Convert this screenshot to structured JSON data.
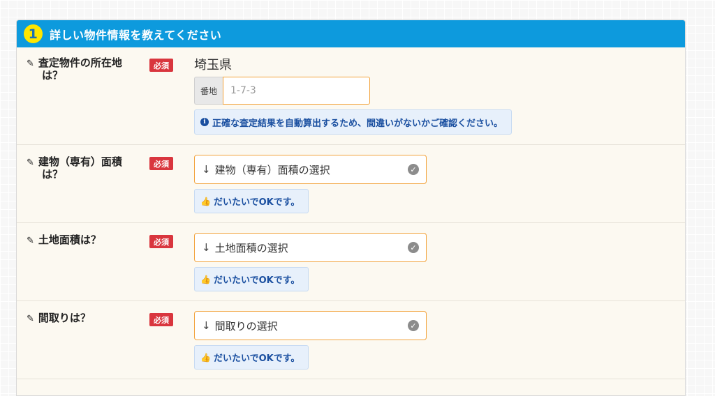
{
  "panel": {
    "step_number": "1",
    "title": "詳しい物件情報を教えてください"
  },
  "required_label": "必須",
  "rows": {
    "location": {
      "label_line1": "査定物件の所在地",
      "label_line2": "は？",
      "prefecture": "埼玉県",
      "address_prefix": "番地",
      "address_value": "1-7-3",
      "note": "正確な査定結果を自動算出するため、間違いがないかご確認ください。"
    },
    "building_area": {
      "label_line1": "建物（専有）面積",
      "label_line2": "は？",
      "select_value": "建物（専有）面積の選択",
      "note": "だいたいでOKです。"
    },
    "land_area": {
      "label_line1": "土地面積は？",
      "select_value": "土地面積の選択",
      "note": "だいたいでOKです。"
    },
    "floor_plan": {
      "label_line1": "間取りは？",
      "select_value": "間取りの選択",
      "note": "だいたいでOKです。"
    }
  },
  "icons": {
    "pencil": "✎",
    "info": "i",
    "arrow_down": "↓",
    "check": "✓",
    "thumbs_up": "👍"
  }
}
